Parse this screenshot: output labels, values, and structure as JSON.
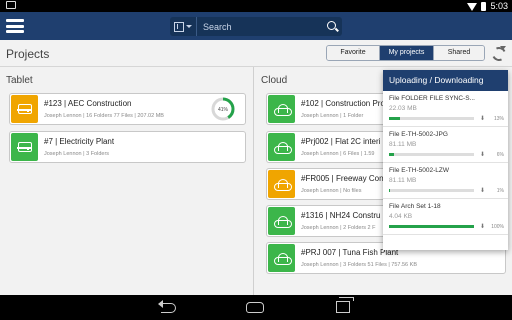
{
  "status": {
    "time": "5:03"
  },
  "search": {
    "placeholder": "Search"
  },
  "header": {
    "title": "Projects",
    "tabs": {
      "favorite": "Favorite",
      "my_projects": "My projects",
      "shared": "Shared"
    }
  },
  "tablet": {
    "title": "Tablet",
    "items": [
      {
        "name": "#123 | AEC Construction",
        "meta": "Joseph Lennon | 16 Folders 77 Files | 207.02 MB",
        "color": "#f0a500",
        "progress": "41%",
        "progress_value": 0.41
      },
      {
        "name": "#7 | Electricity Plant",
        "meta": "Joseph Lennon | 3 Folders",
        "color": "#3cb64a"
      }
    ]
  },
  "cloud": {
    "title": "Cloud",
    "items": [
      {
        "name": "#102 | Construction Pro",
        "meta": "Joseph Lennon | 1 Folder",
        "color": "#3cb64a"
      },
      {
        "name": "#Prj002 | Flat 2C interi",
        "meta": "Joseph Lennon | 6 Files | 1.59",
        "color": "#3cb64a"
      },
      {
        "name": "#FR005 | Freeway Cons",
        "meta": "Joseph Lennon | No files",
        "color": "#f0a500"
      },
      {
        "name": "#1316 | NH24 Constru",
        "meta": "Joseph Lennon | 2 Folders 2 F",
        "color": "#3cb64a"
      },
      {
        "name": "#PRJ 007 | Tuna Fish Plant",
        "meta": "Joseph Lennon | 3 Folders 51 Files | 757.56 KB",
        "color": "#3cb64a"
      }
    ]
  },
  "transfers": {
    "title": "Uploading / Downloading",
    "items": [
      {
        "name": "File FOLDER FILE SYNC-S...",
        "size": "22.03 MB",
        "percent": "13%",
        "value": 0.13
      },
      {
        "name": "File E-TH-5002-JPG",
        "size": "81.11 MB",
        "percent": "6%",
        "value": 0.06
      },
      {
        "name": "File E-TH-5002-LZW",
        "size": "81.11 MB",
        "percent": "1%",
        "value": 0.01
      },
      {
        "name": "File Arch Set 1-18",
        "size": "4.04 KB",
        "percent": "100%",
        "value": 1.0
      }
    ]
  }
}
